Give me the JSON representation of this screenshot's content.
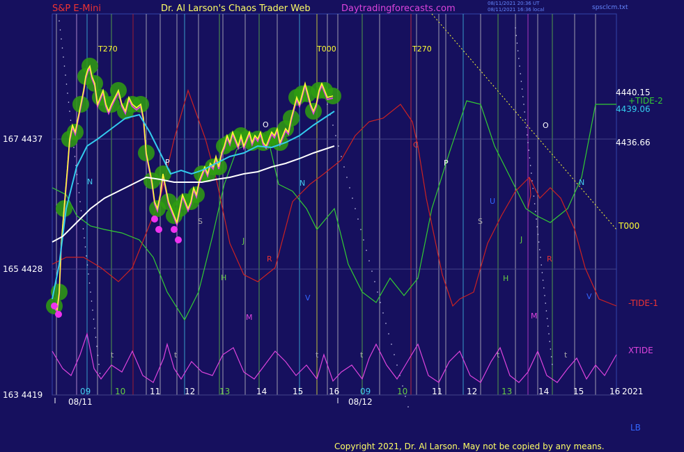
{
  "header": {
    "instrument": "S&P E-Mini",
    "brand": "Dr. Al Larson's Chaos Trader Web",
    "site": "Daytradingforecasts.com",
    "stamp1": "08/11/2021 20:36 UT",
    "stamp2": "08/11/2021 16:36 local",
    "file": "spsclcm.txt"
  },
  "footer": {
    "copyright": "Copyright 2021, Dr. Al Larson. May not be copied by any means.",
    "lb": "LB",
    "year": "2021"
  },
  "chart_data": {
    "type": "line",
    "y_axis_labels": [
      "167  4437",
      "165  4428",
      "163  4419"
    ],
    "right_labels": [
      "4440.15",
      "+TIDE-2",
      "4439.06",
      "4436.66",
      "T000",
      "-TIDE-1",
      "XTIDE"
    ],
    "x_tick_labels": [
      "09",
      "10",
      "11",
      "12",
      "13",
      "14",
      "15",
      "16",
      "09",
      "10",
      "11",
      "12",
      "13",
      "14",
      "15",
      "16"
    ],
    "date_labels": [
      "08/11",
      "08/12"
    ],
    "time_markers": [
      "T270",
      "T000",
      "T270"
    ],
    "line_letters": [
      "N",
      "P",
      "S",
      "H",
      "J",
      "R",
      "M",
      "O",
      "V",
      "N",
      "C",
      "P",
      "S",
      "U",
      "H",
      "J",
      "R",
      "M",
      "O",
      "N",
      "V"
    ],
    "tick_letters": [
      "t",
      "t",
      "t",
      "t",
      "t",
      "t"
    ],
    "price_range": [
      4419,
      4442
    ],
    "colors": {
      "background": "#16105e",
      "price": "#ffff33",
      "price_glow": "#2f9e10",
      "avg_fast": "#33ccee",
      "avg_slow": "#ffffff",
      "tide_green": "#33cc33",
      "tide_red": "#cc2222",
      "xtide": "#dd44dd",
      "header_left": "#ee3333",
      "header_mid": "#ffff66",
      "header_site": "#dd44dd"
    }
  }
}
